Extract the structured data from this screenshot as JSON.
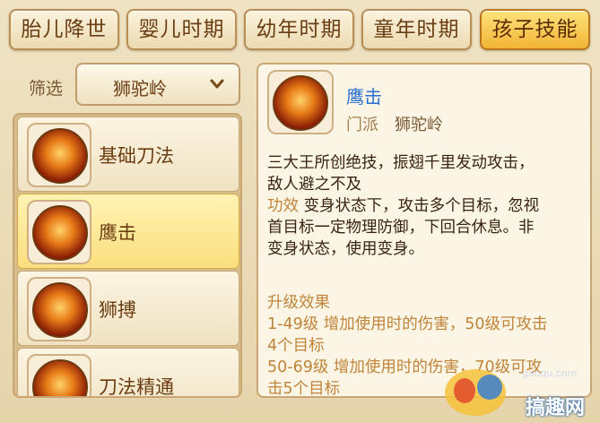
{
  "tabs": [
    "胎儿降世",
    "婴儿时期",
    "幼年时期",
    "童年时期",
    "孩子技能"
  ],
  "active_tab_index": 4,
  "filter": {
    "label": "筛选",
    "value": "狮驼岭"
  },
  "skills": [
    {
      "label": "基础刀法",
      "icon": "claw-flame-icon",
      "selected": false
    },
    {
      "label": "鹰击",
      "icon": "eagle-flame-icon",
      "selected": true
    },
    {
      "label": "狮搏",
      "icon": "lion-flame-icon",
      "selected": false
    },
    {
      "label": "刀法精通",
      "icon": "blade-flame-icon",
      "selected": false
    }
  ],
  "detail": {
    "name": "鹰击",
    "sect_label": "门派",
    "sect_value": "狮驼岭",
    "desc_line1": "三大王所创绝技，振翅千里发动攻击，",
    "desc_line2": "敌人避之不及",
    "effect_label": "功效",
    "effect_text": "变身状态下，攻击多个目标，忽视",
    "effect_line2": "首目标一定物理防御，下回合休息。非",
    "effect_line3": "变身状态，使用变身。",
    "upgrade_title": "升级效果",
    "upgrade_lines": [
      "1-49级 增加使用时的伤害，50级可攻击",
      "4个目标",
      "50-69级 增加使用时的伤害，70级可攻",
      "击5个目标"
    ]
  },
  "watermark": {
    "text": "搞趣网",
    "url": "gaoqu.com"
  },
  "colors": {
    "active_tab": "#f2b437",
    "skill_name": "#2a6fd0",
    "highlight": "#c0843a"
  }
}
